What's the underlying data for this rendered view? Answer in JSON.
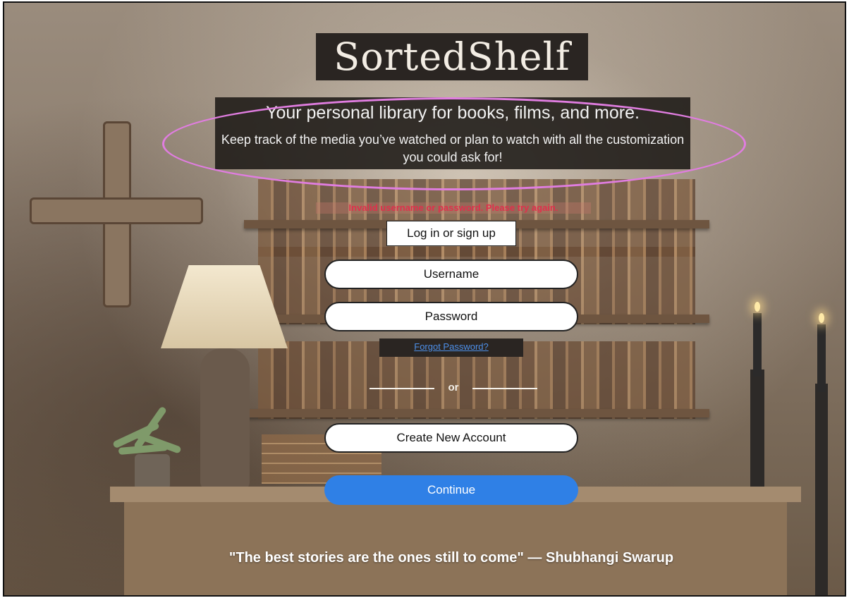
{
  "app": {
    "logo_text": "SortedShelf"
  },
  "hero": {
    "tagline_main": "Your personal library for books, films, and more.",
    "tagline_sub": "Keep track of the media you’ve watched or plan to watch with all the customization you could ask for!"
  },
  "annotation": {
    "highlight_color": "#e07de0"
  },
  "login": {
    "error_message": "Invalid username or password. Please try again.",
    "heading": "Log in or sign up",
    "username_placeholder": "Username",
    "password_placeholder": "Password",
    "forgot_password_link": "Forgot Password?",
    "divider_text": "or",
    "create_account_label": "Create New Account",
    "continue_label": "Continue"
  },
  "footer": {
    "quote": "\"The best stories are the ones still to come\" — Shubhangi Swarup"
  },
  "colors": {
    "error": "#e0304c",
    "link": "#4d8fe8",
    "primary_button": "#2f80e6"
  }
}
